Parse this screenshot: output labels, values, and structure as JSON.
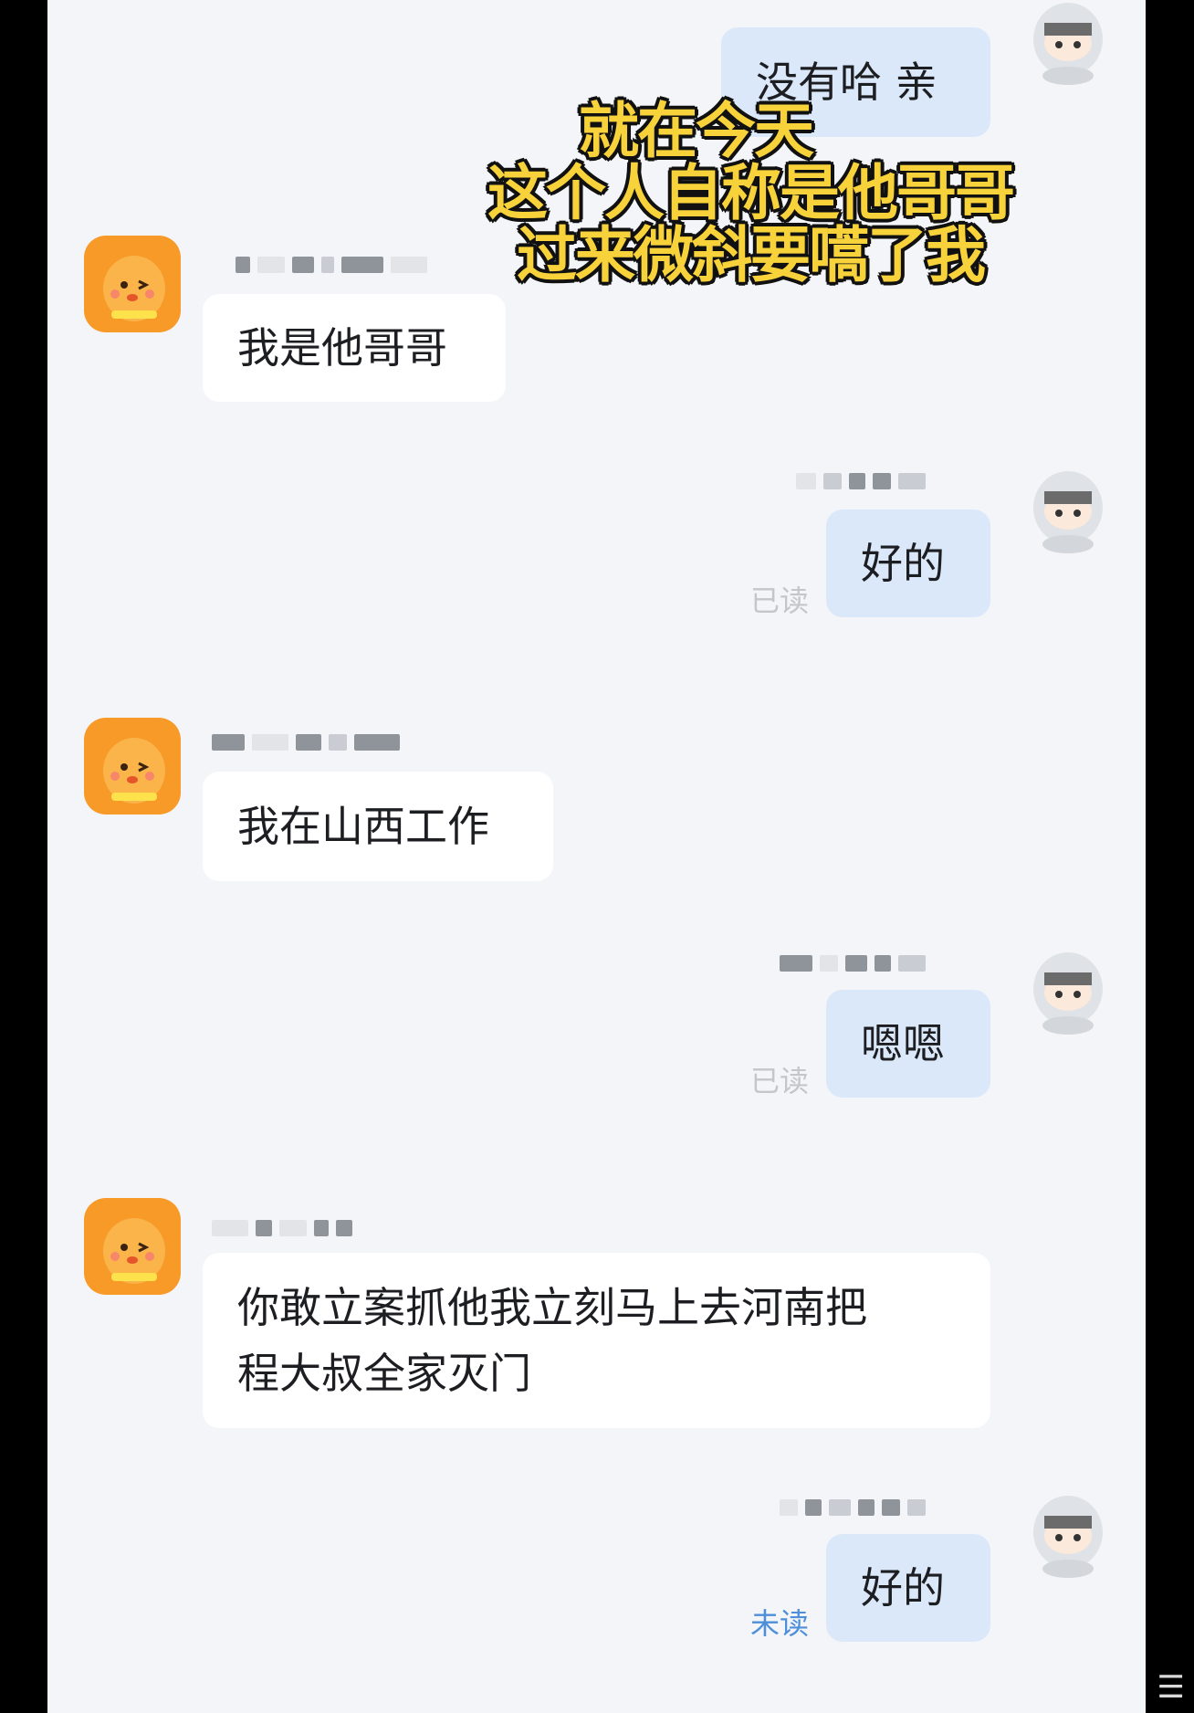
{
  "overlay_caption": {
    "line1": "就在今天",
    "line2": "这个人自称是他哥哥",
    "line3": "过来微斜要嚆了我"
  },
  "messages": [
    {
      "side": "right",
      "text": "没有哈 亲",
      "status": ""
    },
    {
      "side": "left",
      "text": "我是他哥哥"
    },
    {
      "side": "right",
      "text": "好的",
      "status": "已读"
    },
    {
      "side": "left",
      "text": "我在山西工作"
    },
    {
      "side": "right",
      "text": "嗯嗯",
      "status": "已读"
    },
    {
      "side": "left",
      "text_line1": "你敢立案抓他我立刻马上去河南把",
      "text_line2": "程大叔全家灭门"
    },
    {
      "side": "right",
      "text": "好的",
      "status": "未读"
    }
  ],
  "icons": {
    "left_avatar": "orange-mascot-avatar-icon",
    "right_avatar": "hooded-cartoon-avatar-icon",
    "corner": "menu-lines-icon"
  },
  "colors": {
    "background": "#f4f5f9",
    "bubble_left": "#ffffff",
    "bubble_right": "#dbe8fa",
    "read_status": "#c4c6cb",
    "unread_status": "#4d8fd9",
    "caption_text": "#f8d23a",
    "avatar_orange": "#f79a28"
  }
}
